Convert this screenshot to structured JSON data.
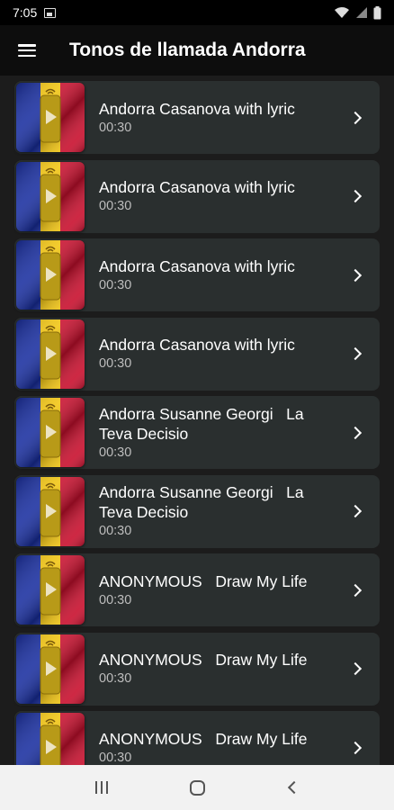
{
  "status": {
    "time": "7:05"
  },
  "app_bar": {
    "title": "Tonos de llamada Andorra"
  },
  "items": [
    {
      "title": "Andorra Casanova with lyric",
      "duration": "00:30"
    },
    {
      "title": "Andorra Casanova with lyric",
      "duration": "00:30"
    },
    {
      "title": "Andorra Casanova with lyric",
      "duration": "00:30"
    },
    {
      "title": "Andorra Casanova with lyric",
      "duration": "00:30"
    },
    {
      "title": "Andorra Susanne Georgi   La Teva Decisio",
      "duration": "00:30"
    },
    {
      "title": "Andorra Susanne Georgi   La Teva Decisio",
      "duration": "00:30"
    },
    {
      "title": "ANONYMOUS   Draw My Life",
      "duration": "00:30"
    },
    {
      "title": "ANONYMOUS   Draw My Life",
      "duration": "00:30"
    },
    {
      "title": "ANONYMOUS   Draw My Life",
      "duration": "00:30"
    }
  ],
  "colors": {
    "flag_blue": "#1a2fa0",
    "flag_yellow": "#f2c511",
    "flag_red": "#c8102e",
    "card_bg": "#2a2f2f"
  }
}
